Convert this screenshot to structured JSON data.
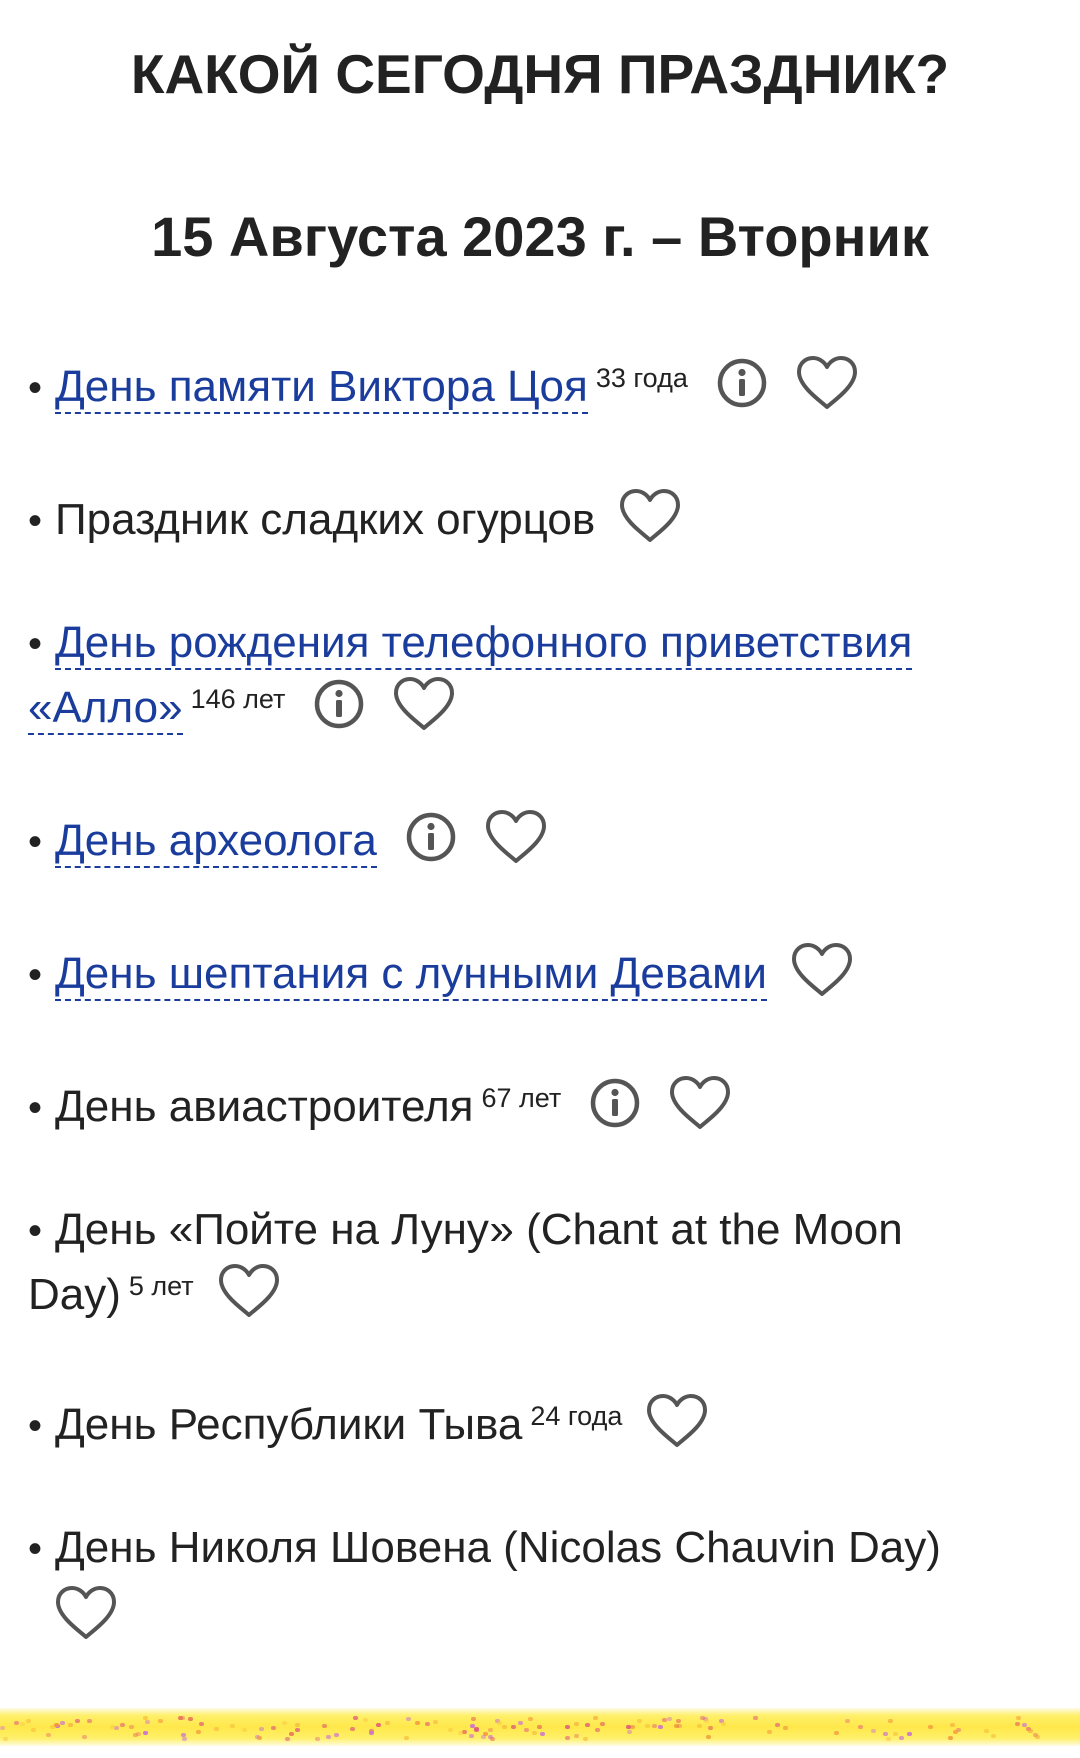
{
  "header": {
    "title": "КАКОЙ СЕГОДНЯ ПРАЗДНИК?",
    "date": "15 Августа 2023 г. – Вторник"
  },
  "holidays": [
    {
      "bullet": "•",
      "line1": "День памяти Виктора Цоя",
      "line2": "",
      "age": "33 года",
      "linked": true,
      "has_info": true
    },
    {
      "bullet": "•",
      "line1": "Праздник сладких огурцов",
      "line2": "",
      "age": "",
      "linked": false,
      "has_info": false
    },
    {
      "bullet": "•",
      "line1": "День рождения телефонного приветствия",
      "line2": "«Алло»",
      "age": "146 лет",
      "linked": true,
      "has_info": true
    },
    {
      "bullet": "•",
      "line1": "День археолога",
      "line2": "",
      "age": "",
      "linked": true,
      "has_info": true
    },
    {
      "bullet": "•",
      "line1": "День шептания с лунными Девами",
      "line2": "",
      "age": "",
      "linked": true,
      "has_info": false
    },
    {
      "bullet": "•",
      "line1": "День авиастроителя",
      "line2": "",
      "age": "67 лет",
      "linked": false,
      "has_info": true
    },
    {
      "bullet": "•",
      "line1": "День «Пойте на Луну» (Chant at the Moon",
      "line2": "Day)",
      "age": "5 лет",
      "linked": false,
      "has_info": false
    },
    {
      "bullet": "•",
      "line1": "День Республики Тыва",
      "line2": "",
      "age": "24 года",
      "linked": false,
      "has_info": false
    },
    {
      "bullet": "•",
      "line1": "День Николя Шовена (Nicolas Chauvin Day)",
      "line2": "",
      "age": "",
      "linked": false,
      "has_info": false
    }
  ],
  "icons": {
    "info": "info-icon",
    "heart": "heart-icon"
  },
  "colors": {
    "link": "#1a3c9c",
    "text": "#222222",
    "icon_stroke": "#555555",
    "footer": "#ffe84a"
  }
}
